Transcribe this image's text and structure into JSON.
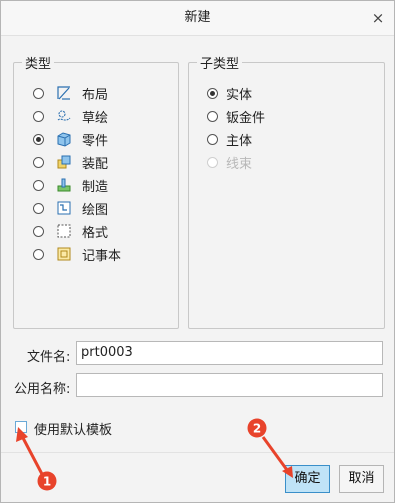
{
  "dialog": {
    "title": "新建",
    "close_label": "×"
  },
  "type_group": {
    "legend": "类型",
    "options": [
      {
        "label": "布局",
        "icon": "layout-icon",
        "selected": false
      },
      {
        "label": "草绘",
        "icon": "sketch-icon",
        "selected": false
      },
      {
        "label": "零件",
        "icon": "part-icon",
        "selected": true
      },
      {
        "label": "装配",
        "icon": "assembly-icon",
        "selected": false
      },
      {
        "label": "制造",
        "icon": "manufacturing-icon",
        "selected": false
      },
      {
        "label": "绘图",
        "icon": "drawing-icon",
        "selected": false
      },
      {
        "label": "格式",
        "icon": "format-icon",
        "selected": false
      },
      {
        "label": "记事本",
        "icon": "notebook-icon",
        "selected": false
      }
    ]
  },
  "subtype_group": {
    "legend": "子类型",
    "options": [
      {
        "label": "实体",
        "selected": true,
        "disabled": false
      },
      {
        "label": "钣金件",
        "selected": false,
        "disabled": false
      },
      {
        "label": "主体",
        "selected": false,
        "disabled": false
      },
      {
        "label": "线束",
        "selected": false,
        "disabled": true
      }
    ]
  },
  "filename": {
    "label": "文件名:",
    "value": "prt0003"
  },
  "common_name": {
    "label": "公用名称:",
    "value": ""
  },
  "template_checkbox": {
    "label": "使用默认模板",
    "checked": false
  },
  "buttons": {
    "ok": "确定",
    "cancel": "取消"
  },
  "annotations": {
    "marker_1": "1",
    "marker_2": "2",
    "color": "#e8432b"
  },
  "colors": {
    "ok_button_bg": "#bfe3f7",
    "ok_button_border": "#3a8fc9"
  }
}
